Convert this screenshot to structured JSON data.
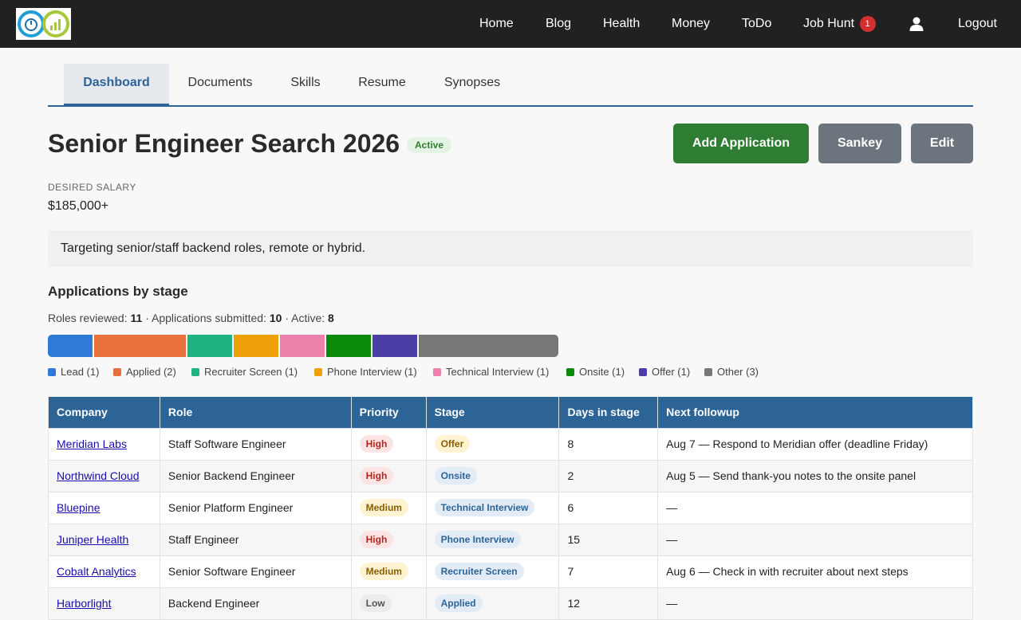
{
  "nav": {
    "items": [
      "Home",
      "Blog",
      "Health",
      "Money",
      "ToDo",
      "Job Hunt"
    ],
    "job_hunt_badge": "1",
    "logout": "Logout"
  },
  "tabs": [
    "Dashboard",
    "Documents",
    "Skills",
    "Resume",
    "Synopses"
  ],
  "header": {
    "title": "Senior Engineer Search 2026",
    "status": "Active",
    "add_button": "Add Application",
    "sankey_button": "Sankey",
    "edit_button": "Edit"
  },
  "salary": {
    "label": "DESIRED SALARY",
    "value": "$185,000+"
  },
  "notes": "Targeting senior/staff backend roles, remote or hybrid.",
  "stages": {
    "title": "Applications by stage",
    "summary": {
      "reviewed_label": "Roles reviewed:",
      "reviewed": "11",
      "submitted_label": "Applications submitted:",
      "submitted": "10",
      "active_label": "Active:",
      "active": "8"
    },
    "items": [
      {
        "name": "Lead",
        "count": 1,
        "color": "#2f7ad6"
      },
      {
        "name": "Applied",
        "count": 2,
        "color": "#e8703a"
      },
      {
        "name": "Recruiter Screen",
        "count": 1,
        "color": "#1fb384"
      },
      {
        "name": "Phone Interview",
        "count": 1,
        "color": "#eea10b"
      },
      {
        "name": "Technical Interview",
        "count": 1,
        "color": "#ec82ab"
      },
      {
        "name": "Onsite",
        "count": 1,
        "color": "#0a8a0a"
      },
      {
        "name": "Offer",
        "count": 1,
        "color": "#4b3fa5"
      },
      {
        "name": "Other",
        "count": 3,
        "color": "#777777"
      }
    ]
  },
  "table": {
    "headers": [
      "Company",
      "Role",
      "Priority",
      "Stage",
      "Days in stage",
      "Next followup"
    ],
    "rows": [
      {
        "company": "Meridian Labs",
        "role": "Staff Software Engineer",
        "priority": "High",
        "stage": "Offer",
        "days": "8",
        "followup": "Aug 7 — Respond to Meridian offer (deadline Friday)"
      },
      {
        "company": "Northwind Cloud",
        "role": "Senior Backend Engineer",
        "priority": "High",
        "stage": "Onsite",
        "days": "2",
        "followup": "Aug 5 — Send thank-you notes to the onsite panel"
      },
      {
        "company": "Bluepine",
        "role": "Senior Platform Engineer",
        "priority": "Medium",
        "stage": "Technical Interview",
        "days": "6",
        "followup": "—"
      },
      {
        "company": "Juniper Health",
        "role": "Staff Engineer",
        "priority": "High",
        "stage": "Phone Interview",
        "days": "15",
        "followup": "—"
      },
      {
        "company": "Cobalt Analytics",
        "role": "Senior Software Engineer",
        "priority": "Medium",
        "stage": "Recruiter Screen",
        "days": "7",
        "followup": "Aug 6 — Check in with recruiter about next steps"
      },
      {
        "company": "Harborlight",
        "role": "Backend Engineer",
        "priority": "Low",
        "stage": "Applied",
        "days": "12",
        "followup": "—"
      }
    ]
  }
}
